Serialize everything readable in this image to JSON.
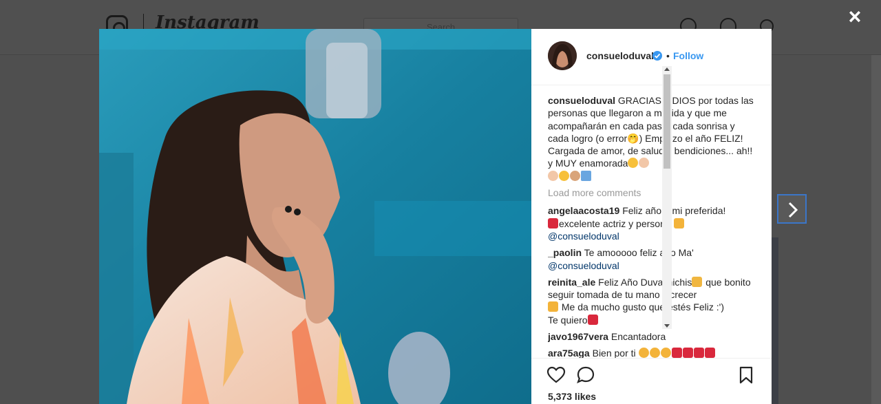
{
  "background": {
    "brand": "Instagram",
    "search_placeholder": "Search"
  },
  "post": {
    "username": "consueloduval",
    "separator": "•",
    "follow_label": "Follow",
    "caption": {
      "username": "consueloduval",
      "text": "GRACIAS A DIOS por todas las personas que llegaron a mi vida y que me acompañarán en cada paso, cada sonrisa y cada logro (o error🤭) Empiezo el año FELIZ! Cargada de amor, de salud y bendiciones... ah!! y MUY enamorada"
    },
    "load_more_label": "Load more comments",
    "comments": [
      {
        "username": "angelaacosta19",
        "text_1": "Feliz año a mi preferida!",
        "text_2": "excelente actriz y persona",
        "mention": "@consueloduval"
      },
      {
        "username": "_paolin",
        "text_1": "Te amooooo feliz año Ma'",
        "mention": "@consueloduval"
      },
      {
        "username": "reinita_ale",
        "text_1": "Feliz Año Duvalinichis",
        "text_2": "que bonito seguir tomada de tu mano y crecer",
        "text_3": "Me da mucho gusto que estés Feliz :')",
        "text_4": "Te quiero"
      },
      {
        "username": "javo1967vera",
        "text_1": "Encantadora"
      },
      {
        "username": "ara75aga",
        "text_1": "Bien por ti"
      }
    ],
    "likes_label": "5,373 likes"
  },
  "icons": {
    "close": "close-icon",
    "next": "chevron-right-icon",
    "like": "heart-icon",
    "comment": "comment-icon",
    "save": "bookmark-icon",
    "verified": "verified-badge-icon"
  },
  "colors": {
    "link": "#3897f0",
    "verified": "#3897f0",
    "overlay": "#4f4f4f",
    "mention": "#003569"
  }
}
